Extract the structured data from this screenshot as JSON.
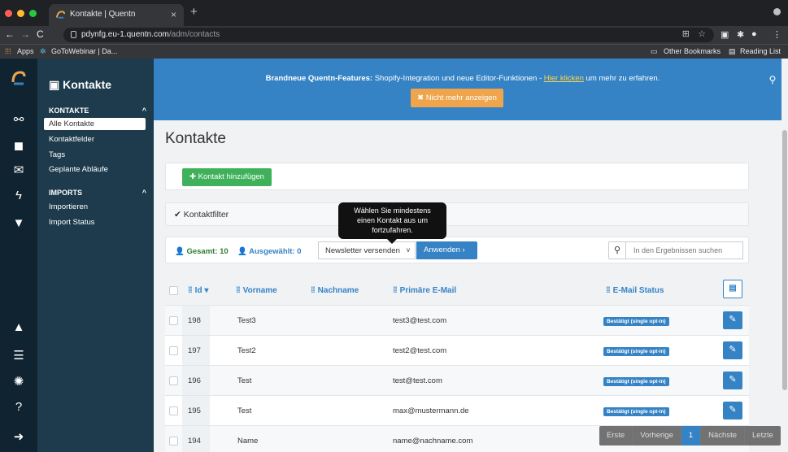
{
  "browser": {
    "tab_title": "Kontakte | Quentn",
    "url_host": "pdynfg.eu-1.quentn.com",
    "url_path": "/adm/contacts",
    "bookmarks": [
      "Apps",
      "GoToWebinar | Da..."
    ],
    "bookmarks_right": [
      "Other Bookmarks",
      "Reading List"
    ]
  },
  "sidebar": {
    "title": "Kontakte",
    "sections": [
      {
        "label": "KONTAKTE",
        "items": [
          "Alle Kontakte",
          "Kontaktfelder",
          "Tags",
          "Geplante Abläufe"
        ]
      },
      {
        "label": "IMPORTS",
        "items": [
          "Importieren",
          "Import Status"
        ]
      }
    ]
  },
  "banner": {
    "bold": "Brandneue Quentn-Features:",
    "text1": " Shopify-Integration und neue Editor-Funktionen - ",
    "link": "Hier klicken",
    "text2": " um mehr zu erfahren.",
    "dismiss": "Nicht mehr anzeigen"
  },
  "main": {
    "title": "Kontakte",
    "add_label": "Kontakt hinzufügen",
    "filter_label": "Kontaktfilter",
    "tooltip": "Wählen Sie mindestens einen Kontakt aus um fortzufahren.",
    "total_label": "Gesamt: 10",
    "selected_label": "Ausgewählt: 0",
    "action_value": "Newsletter versenden",
    "apply_label": "Anwenden",
    "search_placeholder": "In den Ergebnissen suchen"
  },
  "table": {
    "columns": [
      "Id",
      "Vorname",
      "Nachname",
      "Primäre E-Mail",
      "E-Mail Status"
    ],
    "rows": [
      {
        "id": "198",
        "vorname": "Test3",
        "nachname": "",
        "email": "test3@test.com",
        "status": "Bestätigt (single opt-in)"
      },
      {
        "id": "197",
        "vorname": "Test2",
        "nachname": "",
        "email": "test2@test.com",
        "status": "Bestätigt (single opt-in)"
      },
      {
        "id": "196",
        "vorname": "Test",
        "nachname": "",
        "email": "test@test.com",
        "status": "Bestätigt (single opt-in)"
      },
      {
        "id": "195",
        "vorname": "Test",
        "nachname": "",
        "email": "max@mustermann.de",
        "status": "Bestätigt (single opt-in)"
      },
      {
        "id": "194",
        "vorname": "Name",
        "nachname": "",
        "email": "name@nachname.com",
        "status": ""
      }
    ]
  },
  "pager": {
    "first": "Erste",
    "prev": "Vorherige",
    "current": "1",
    "next": "Nächste",
    "last": "Letzte"
  },
  "colors": {
    "brand": "#3583c5",
    "sidebar": "#1d3b4c",
    "rail": "#0f2430",
    "success": "#3fb15a",
    "warning": "#f0a54d"
  }
}
